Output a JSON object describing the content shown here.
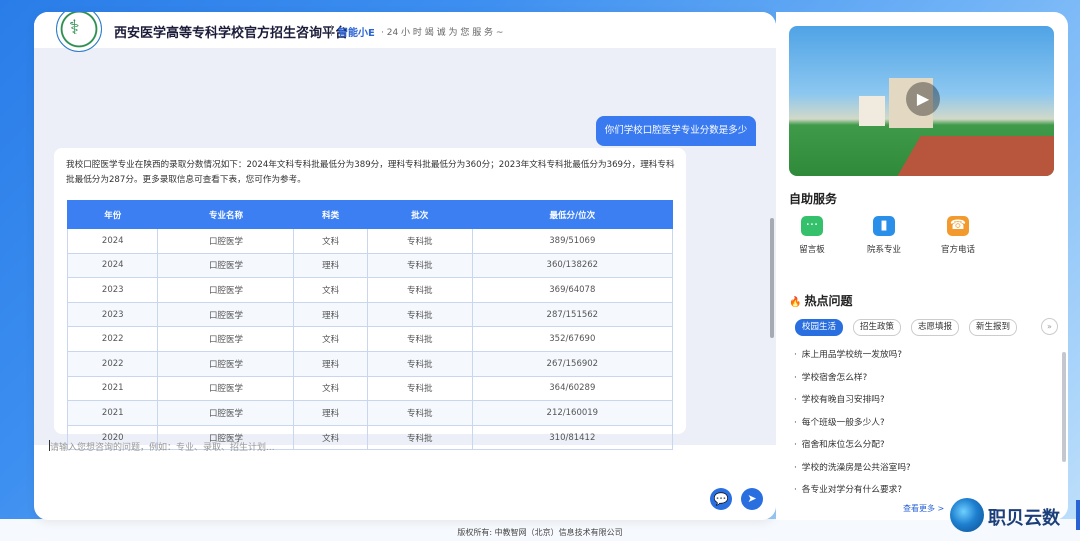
{
  "header": {
    "title": "西安医学高等专科学校官方招生咨询平台",
    "bot_name": "智能小E",
    "bot_tagline": "· 24 小 时 竭 诚 为 您 服 务 ~"
  },
  "chat": {
    "user_message": "你们学校口腔医学专业分数是多少",
    "bot_reply": "我校口腔医学专业在陕西的录取分数情况如下：2024年文科专科批最低分为389分，理科专科批最低分为360分；2023年文科专科批最低分为369分，理科专科批最低分为287分。更多录取信息可查看下表，您可作为参考。",
    "table": {
      "headers": [
        "年份",
        "专业名称",
        "科类",
        "批次",
        "最低分/位次"
      ],
      "rows": [
        [
          "2024",
          "口腔医学",
          "文科",
          "专科批",
          "389/51069"
        ],
        [
          "2024",
          "口腔医学",
          "理科",
          "专科批",
          "360/138262"
        ],
        [
          "2023",
          "口腔医学",
          "文科",
          "专科批",
          "369/64078"
        ],
        [
          "2023",
          "口腔医学",
          "理科",
          "专科批",
          "287/151562"
        ],
        [
          "2022",
          "口腔医学",
          "文科",
          "专科批",
          "352/67690"
        ],
        [
          "2022",
          "口腔医学",
          "理科",
          "专科批",
          "267/156902"
        ],
        [
          "2021",
          "口腔医学",
          "文科",
          "专科批",
          "364/60289"
        ],
        [
          "2021",
          "口腔医学",
          "理科",
          "专科批",
          "212/160019"
        ],
        [
          "2020",
          "口腔医学",
          "文科",
          "专科批",
          "310/81412"
        ]
      ]
    },
    "input_placeholder": "请输入您想咨询的问题，例如：专业、录取、招生计划..."
  },
  "sidebar": {
    "self_service_title": "自助服务",
    "services": [
      {
        "label": "留言板",
        "icon": "message-board-icon",
        "color": "#35c06b"
      },
      {
        "label": "院系专业",
        "icon": "book-icon",
        "color": "#2a8fe8"
      },
      {
        "label": "官方电话",
        "icon": "phone-icon",
        "color": "#f29a2e"
      }
    ],
    "hot_title": "热点问题",
    "tabs": [
      "校园生活",
      "招生政策",
      "志愿填报",
      "新生报到"
    ],
    "tab_more": "»",
    "questions": [
      "床上用品学校统一发放吗?",
      "学校宿舍怎么样?",
      "学校有晚自习安排吗?",
      "每个班级一般多少人?",
      "宿舍和床位怎么分配?",
      "学校的洗澡房是公共浴室吗?",
      "各专业对学分有什么要求?"
    ],
    "more_label": "查看更多 >"
  },
  "footer": "版权所有: 中教智网（北京）信息技术有限公司",
  "watermark": "职贝云数",
  "colors": {
    "accent": "#2a6fe0",
    "table_header": "#3b7ff2"
  }
}
